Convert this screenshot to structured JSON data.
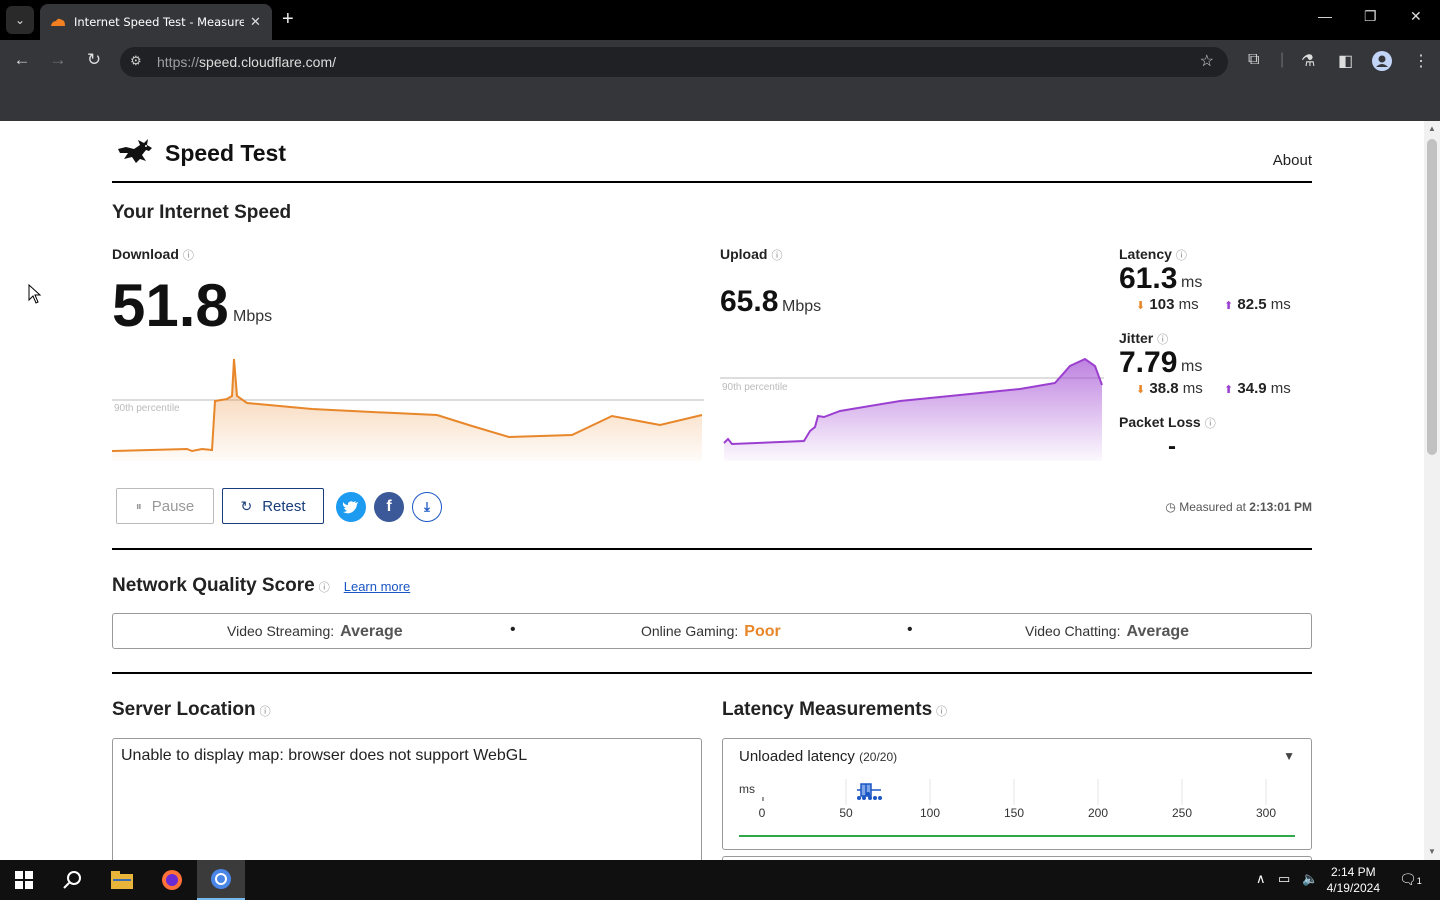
{
  "browser": {
    "tab_title": "Internet Speed Test - Measure",
    "url_scheme": "https://",
    "url_rest": "speed.cloudflare.com/"
  },
  "site": {
    "title": "Speed Test",
    "about": "About"
  },
  "speed": {
    "heading": "Your Internet Speed",
    "download_label": "Download",
    "download_value": "51.8",
    "download_unit": "Mbps",
    "upload_label": "Upload",
    "upload_value": "65.8",
    "upload_unit": "Mbps",
    "percentile_label": "90th percentile",
    "latency_label": "Latency",
    "latency_value": "61.3",
    "latency_unit": "ms",
    "latency_down": "103",
    "latency_up": "82.5",
    "jitter_label": "Jitter",
    "jitter_value": "7.79",
    "jitter_unit": "ms",
    "jitter_down": "38.8",
    "jitter_up": "34.9",
    "sub_unit": "ms",
    "packet_loss_label": "Packet Loss",
    "packet_loss_value": "-",
    "pause_label": "Pause",
    "retest_label": "Retest",
    "measured_prefix": "Measured at",
    "measured_time": "2:13:01 PM"
  },
  "nqs": {
    "heading": "Network Quality Score",
    "learn_more": "Learn more",
    "items": [
      {
        "label": "Video Streaming:",
        "value": "Average"
      },
      {
        "label": "Online Gaming:",
        "value": "Poor"
      },
      {
        "label": "Video Chatting:",
        "value": "Average"
      }
    ],
    "dot": "•"
  },
  "server": {
    "heading": "Server Location",
    "map_message": "Unable to display map: browser does not support WebGL"
  },
  "latency_measurements": {
    "heading": "Latency Measurements",
    "panel_title": "Unloaded latency",
    "panel_count": "(20/20)",
    "axis_unit": "ms",
    "ticks": [
      "0",
      "50",
      "100",
      "150",
      "200",
      "250",
      "300"
    ]
  },
  "taskbar": {
    "time": "2:14 PM",
    "date": "4/19/2024",
    "notifications": "1"
  },
  "colors": {
    "download": "#e8862a",
    "upload": "#9b3fd0",
    "twitter": "#1d9bf0",
    "facebook": "#3b5998",
    "download_btn": "#1a56c4",
    "retest_border": "#1a3c7a"
  }
}
